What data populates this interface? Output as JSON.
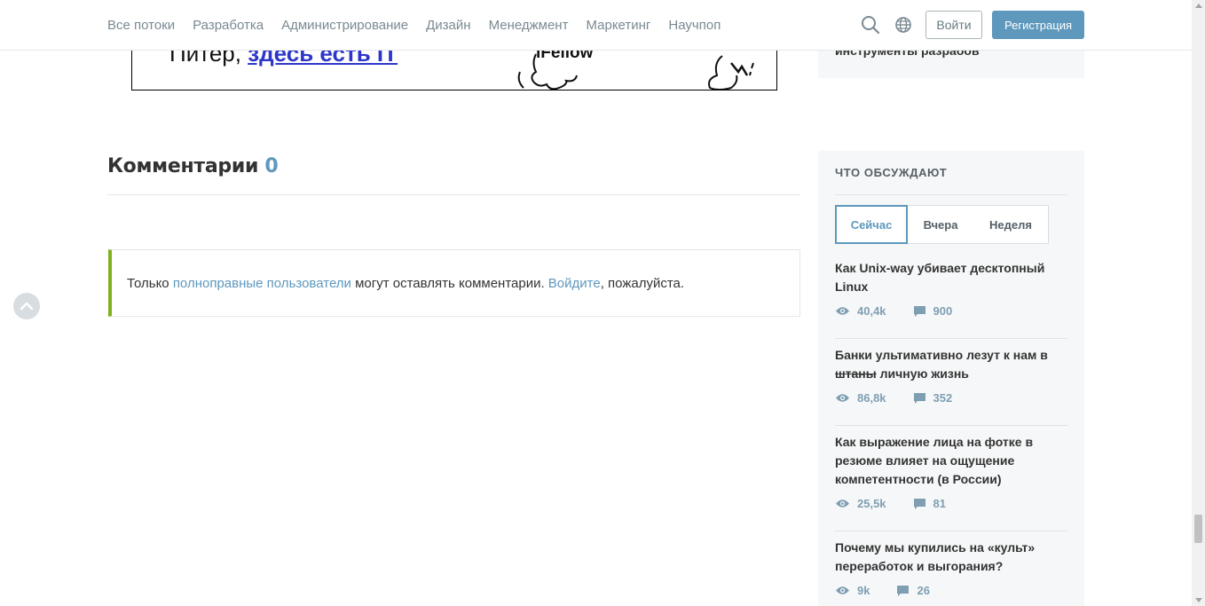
{
  "header": {
    "nav": [
      "Все потоки",
      "Разработка",
      "Администрирование",
      "Дизайн",
      "Менеджмент",
      "Маркетинг",
      "Научпоп"
    ],
    "login_label": "Войти",
    "register_label": "Регистрация",
    "icons": [
      "search-icon",
      "globe-icon"
    ],
    "accent_color": "#5e98bd"
  },
  "banner": {
    "text_prefix": "Питер, ",
    "text_link": "здесь есть IT",
    "logo": "iFellow"
  },
  "comments": {
    "title": "Комментарии",
    "count": "0",
    "notice_before": "Только ",
    "notice_link1": "полноправные пользователи",
    "notice_middle": " могут оставлять комментарии. ",
    "notice_link2": "Войдите",
    "notice_after": ", пожалуйста.",
    "notice_border_color": "#7fb11e"
  },
  "sidebar": {
    "top_block_text": "инструменты разрабов",
    "title": "Что обсуждают",
    "tabs": [
      "Сейчас",
      "Вчера",
      "Неделя"
    ],
    "active_tab": "Сейчас",
    "posts": [
      {
        "title": "Как Unix-way убивает десктопный Linux",
        "views": "40,4k",
        "comments": "900"
      },
      {
        "title_struck": "штаны",
        "title_before": "Банки ультимативно лезут к нам в ",
        "title_after": " личную жизнь",
        "views": "86,8k",
        "comments": "352"
      },
      {
        "title": "Как выражение лица на фотке в резюме влияет на ощущение компетентности (в России)",
        "views": "25,5k",
        "comments": "81"
      },
      {
        "title": "Почему мы купились на «культ» переработок и выгорания?",
        "views": "9k",
        "comments": "26"
      }
    ]
  }
}
